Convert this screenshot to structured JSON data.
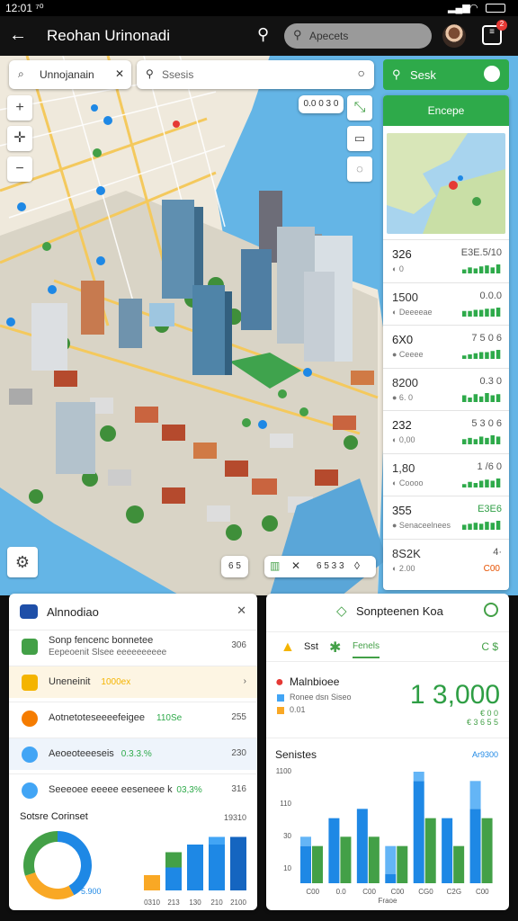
{
  "status_bar": {
    "time": "12:01 ⁷⁰"
  },
  "app_bar": {
    "title": "Reohan Urinonadi",
    "search_placeholder": "Apecets",
    "cart_badge": "2"
  },
  "map_search": {
    "location_value": "Unnojanain",
    "search_placeholder": "Ssesis"
  },
  "map_right": {
    "top_label": "0.0 0 3 0"
  },
  "map_bottom": {
    "zoom_label": "6 5",
    "scale_label": "6 5 3 3"
  },
  "right_panel": {
    "search_button": "Sesk",
    "action_button": "Encepe",
    "stats": [
      {
        "value": "326",
        "value_right": "E3E.5/10",
        "label": "◐ 0",
        "trend": [
          4,
          6,
          5,
          7,
          8,
          6,
          9
        ]
      },
      {
        "value": "1500",
        "value_right": "0.0.0",
        "label": "◐ Deeeeae",
        "trend": [
          5,
          5,
          6,
          6,
          7,
          7,
          8
        ]
      },
      {
        "value": "6X0",
        "value_right": "7 5 0 6",
        "label": "● Ceeee",
        "trend": [
          3,
          4,
          5,
          6,
          6,
          7,
          8
        ]
      },
      {
        "value": "8200",
        "value_right": "0.3 0",
        "label": "● 6. 0",
        "trend": [
          6,
          4,
          7,
          5,
          8,
          6,
          7
        ]
      },
      {
        "value": "232",
        "value_right": "5 3 0 6",
        "label": "◐ 0,00",
        "trend": [
          4,
          5,
          4,
          6,
          5,
          7,
          6
        ]
      },
      {
        "value": "1,80",
        "value_right": "1 /6 0",
        "label": "◐ Coooo",
        "trend": [
          3,
          5,
          4,
          6,
          7,
          6,
          8
        ]
      },
      {
        "value": "355",
        "value_right": "E3E6",
        "label": "● Senaceelnees",
        "trend": [
          5,
          6,
          7,
          6,
          8,
          7,
          9
        ]
      },
      {
        "value": "8S2K",
        "value_right": "4·",
        "label": "◐ 2.00",
        "value_right2": "C00"
      }
    ]
  },
  "left_card": {
    "title": "Alnnodiao",
    "rows": [
      {
        "text": "Sonp fencenc bonnetee",
        "sub": "Eepeoenit Slsee eeeeeeeeee",
        "value": "306",
        "color": "#43a047"
      },
      {
        "text": "Uneneinit",
        "accent": "1000ex",
        "value": "›",
        "color": "#f4b400"
      },
      {
        "text": "Aotnetoteseeeefeigee",
        "accent": "110Se",
        "value": "255",
        "color": "#f57c00"
      },
      {
        "text": "Aeoeoteeeseis",
        "accent": "0.3.3.%",
        "value": "230",
        "color": "#42a5f5"
      },
      {
        "text": "Seeeoee eeeee eeseneee k",
        "accent": "03,3%",
        "value": "316",
        "color": "#42a5f5"
      }
    ],
    "section_title": "Sotsre Corinset",
    "section_value": "19310",
    "donut_center": "5.900",
    "donut_values": [
      42,
      28,
      30
    ],
    "donut_colors": [
      "#1e88e5",
      "#f9a825",
      "#43a047"
    ],
    "bars": [
      {
        "label": "0310",
        "values": [
          2,
          0
        ],
        "colors": [
          "#f9a825",
          "#42a5f5"
        ]
      },
      {
        "label": "213",
        "values": [
          3,
          2
        ],
        "colors": [
          "#1e88e5",
          "#43a047"
        ]
      },
      {
        "label": "130",
        "values": [
          6,
          0
        ],
        "colors": [
          "#1e88e5",
          "#42a5f5"
        ]
      },
      {
        "label": "210",
        "values": [
          6,
          1
        ],
        "colors": [
          "#1e88e5",
          "#42a5f5"
        ]
      },
      {
        "label": "2100",
        "values": [
          7,
          0
        ],
        "colors": [
          "#1565c0",
          "#42a5f5"
        ]
      }
    ]
  },
  "right_card": {
    "title": "Sonpteenen Koa",
    "tabs": [
      {
        "label": "Sst",
        "color": "#f4b400"
      },
      {
        "label": "Fenels",
        "color": "#43a047"
      }
    ],
    "tab_value": "C $",
    "legend_title": "Malnbioee",
    "legend": [
      {
        "label": "Ronee dsn Siseo",
        "color": "#42a5f5"
      },
      {
        "label": "0.01",
        "color": "#f9a825"
      }
    ],
    "big_value": "1 3,000",
    "big_sub": "€ 0 0",
    "big_sub2": "€ 3 6 5 5",
    "chart_title": "Senistes",
    "chart_value": "Ar9300"
  },
  "chart_data": {
    "type": "bar",
    "title": "Senistes",
    "categories": [
      "C00",
      "0.0",
      "C00",
      "C00",
      "CG0",
      "C2G",
      "C00"
    ],
    "yticks": [
      "1100",
      "110",
      "30",
      "10"
    ],
    "xlabel": "Fraoe",
    "ylim": [
      0,
      12
    ],
    "series": [
      {
        "values": [
          4,
          7,
          8,
          1,
          11,
          7,
          8
        ],
        "color": "#1e88e5"
      },
      {
        "values": [
          4,
          5,
          5,
          4,
          7,
          4,
          7
        ],
        "color": "#43a047"
      },
      {
        "values": [
          1,
          0,
          0,
          3,
          1,
          0,
          3
        ],
        "color": "#64b5f6"
      }
    ],
    "grid": false,
    "legend": "none"
  }
}
